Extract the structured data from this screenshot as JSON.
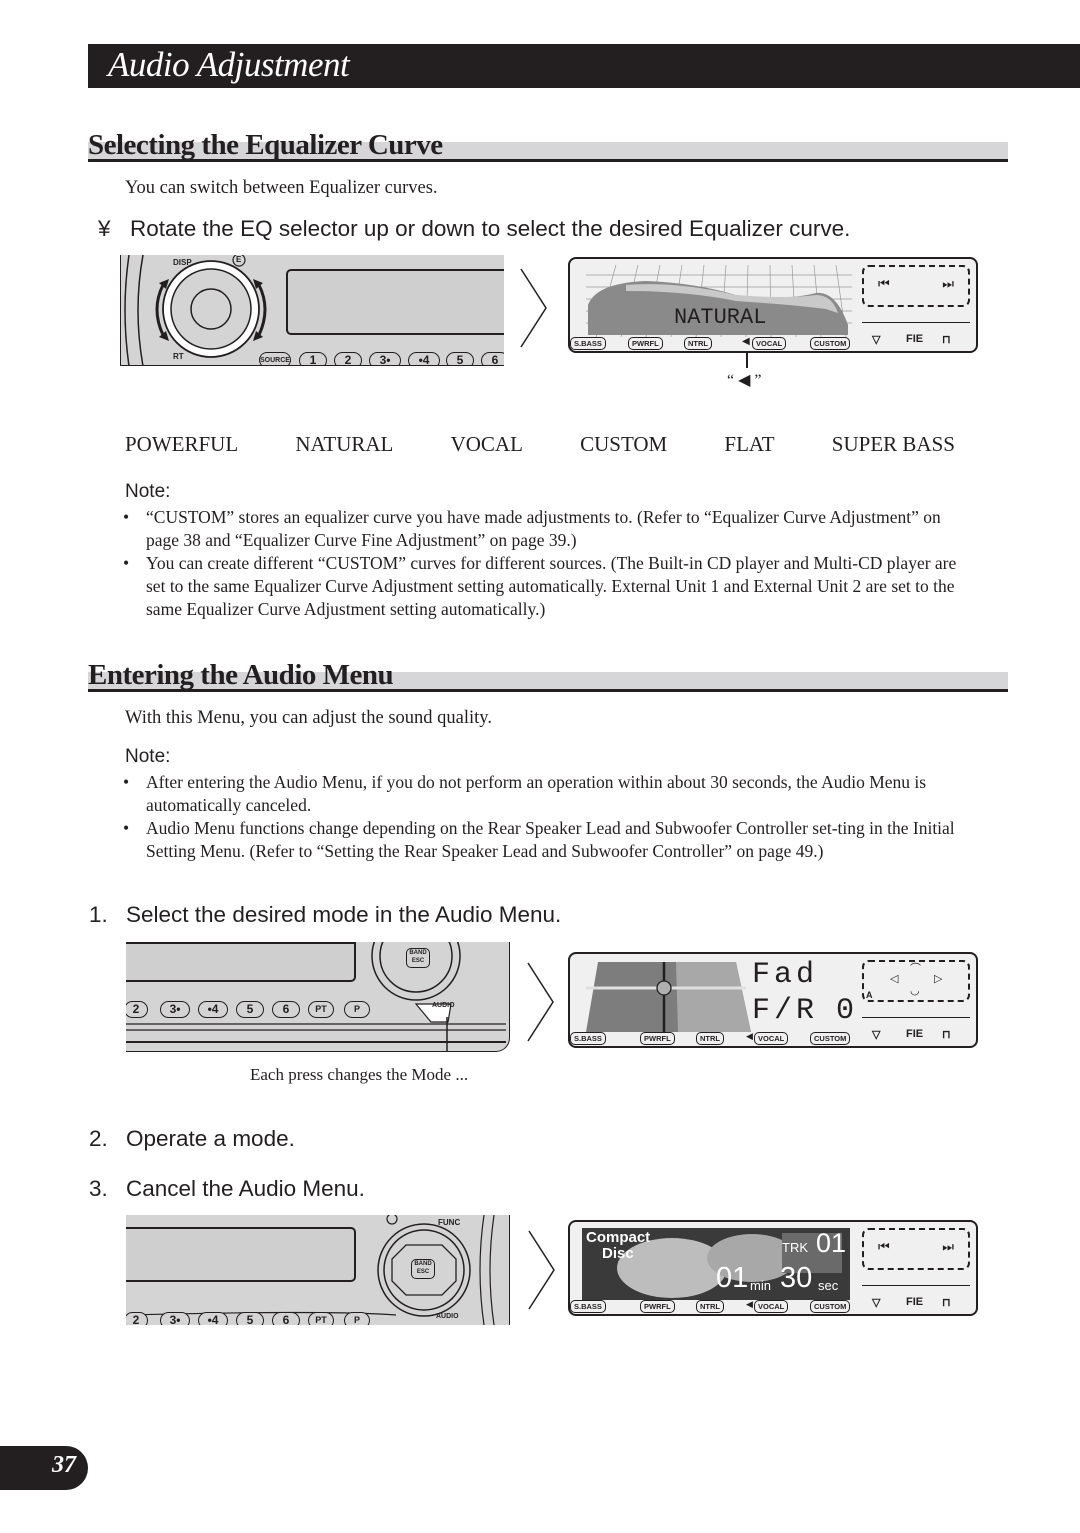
{
  "header": {
    "title": "Audio Adjustment"
  },
  "section1": {
    "heading": "Selecting the Equalizer Curve",
    "intro": "You can switch between Equalizer curves.",
    "instruction_marker": "¥",
    "instruction": "Rotate the EQ selector up or down to select the desired Equalizer curve.",
    "panel": {
      "labels": {
        "disp": "DISP",
        "e": "E",
        "rt": "RT",
        "source": "SOURCE"
      },
      "buttons": [
        "1",
        "2",
        "3•",
        "•4",
        "5",
        "6"
      ]
    },
    "display": {
      "mode_text": "NATURAL",
      "indicator_caption": "“ ◀ ”",
      "tabs": [
        "S.BASS",
        "PWRFL",
        "NTRL",
        "VOCAL",
        "CUSTOM"
      ],
      "fie_label": "FIE"
    },
    "eq_curves": [
      "POWERFUL",
      "NATURAL",
      "VOCAL",
      "CUSTOM",
      "FLAT",
      "SUPER BASS"
    ],
    "note_label": "Note:",
    "notes": [
      "“CUSTOM” stores an equalizer curve you have made adjustments to. (Refer to “Equalizer Curve Adjustment” on page 38 and “Equalizer Curve Fine Adjustment” on page 39.)",
      "You can create different “CUSTOM” curves for different sources. (The Built-in CD player and Multi-CD player are set to the same Equalizer Curve Adjustment setting automatically. External Unit 1 and External Unit 2 are set to the same Equalizer Curve Adjustment setting automatically.)"
    ]
  },
  "section2": {
    "heading": "Entering the Audio Menu",
    "intro": "With this Menu, you can adjust the sound quality.",
    "note_label": "Note:",
    "notes": [
      "After entering the Audio Menu, if you do not perform an operation within about 30 seconds, the Audio Menu is automatically canceled.",
      "Audio Menu functions change depending on the Rear Speaker Lead and Subwoofer Controller set-ting in the Initial Setting Menu. (Refer to “Setting the Rear Speaker Lead and Subwoofer Controller” on page 49.)"
    ],
    "steps": [
      {
        "num": "1.",
        "text": "Select the desired mode in the Audio Menu."
      },
      {
        "num": "2.",
        "text": "Operate a mode."
      },
      {
        "num": "3.",
        "text": "Cancel the Audio Menu."
      }
    ],
    "panel1": {
      "buttons": [
        "2",
        "3•",
        "•4",
        "5",
        "6",
        "PT",
        "P"
      ],
      "labels": {
        "band": "BAND",
        "esc": "ESC",
        "audio": "AUDIO"
      },
      "caption": "Each press changes the Mode ..."
    },
    "display1": {
      "line1": "Fad",
      "line2_label": "F/R",
      "line2_value": "0",
      "corner_label": "A",
      "tabs": [
        "S.BASS",
        "PWRFL",
        "NTRL",
        "VOCAL",
        "CUSTOM"
      ],
      "fie_label": "FIE"
    },
    "panel2": {
      "buttons": [
        "2",
        "3•",
        "•4",
        "5",
        "6",
        "PT",
        "P"
      ],
      "labels": {
        "func": "FUNC",
        "band": "BAND",
        "esc": "ESC",
        "audio": "AUDIO"
      }
    },
    "display2": {
      "source_line1": "Compact",
      "source_line2": "Disc",
      "trk_label": "TRK",
      "trk_value": "01",
      "min_value": "01",
      "min_label": "min",
      "sec_value": "30",
      "sec_label": "sec",
      "tabs": [
        "S.BASS",
        "PWRFL",
        "NTRL",
        "VOCAL",
        "CUSTOM"
      ],
      "fie_label": "FIE"
    }
  },
  "footer": {
    "page_number": "37"
  }
}
